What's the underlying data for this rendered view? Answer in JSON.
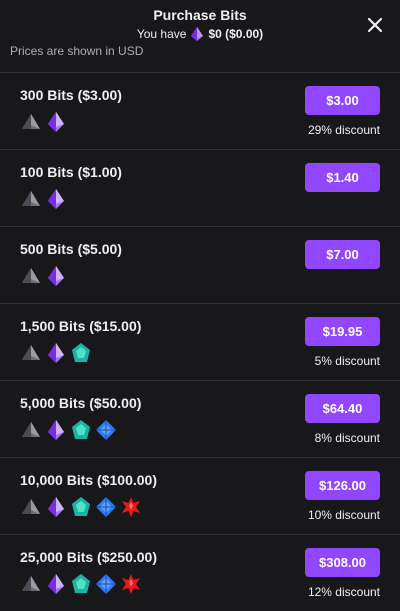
{
  "header": {
    "title": "Purchase Bits",
    "balance_prefix": "You have",
    "balance_amount": "$0 ($0.00)",
    "close_icon": "close-icon"
  },
  "prices_note": "Prices are shown in USD",
  "colors": {
    "accent": "#9147ff",
    "background": "#18181b",
    "gem_gray": "#6e6e78",
    "gem_purple": "#a970ff",
    "gem_teal": "#1db2a5",
    "gem_blue": "#2e7bf6",
    "gem_red": "#e91916"
  },
  "offers": [
    {
      "label": "300 Bits ($3.00)",
      "price": "$3.00",
      "discount": "29% discount",
      "gems": [
        "gray",
        "purple"
      ]
    },
    {
      "label": "100 Bits ($1.00)",
      "price": "$1.40",
      "discount": "",
      "gems": [
        "gray",
        "purple"
      ]
    },
    {
      "label": "500 Bits ($5.00)",
      "price": "$7.00",
      "discount": "",
      "gems": [
        "gray",
        "purple"
      ]
    },
    {
      "label": "1,500 Bits ($15.00)",
      "price": "$19.95",
      "discount": "5% discount",
      "gems": [
        "gray",
        "purple",
        "teal"
      ]
    },
    {
      "label": "5,000 Bits ($50.00)",
      "price": "$64.40",
      "discount": "8% discount",
      "gems": [
        "gray",
        "purple",
        "teal",
        "blue"
      ]
    },
    {
      "label": "10,000 Bits ($100.00)",
      "price": "$126.00",
      "discount": "10% discount",
      "gems": [
        "gray",
        "purple",
        "teal",
        "blue",
        "red"
      ]
    },
    {
      "label": "25,000 Bits ($250.00)",
      "price": "$308.00",
      "discount": "12% discount",
      "gems": [
        "gray",
        "purple",
        "teal",
        "blue",
        "red"
      ]
    }
  ]
}
